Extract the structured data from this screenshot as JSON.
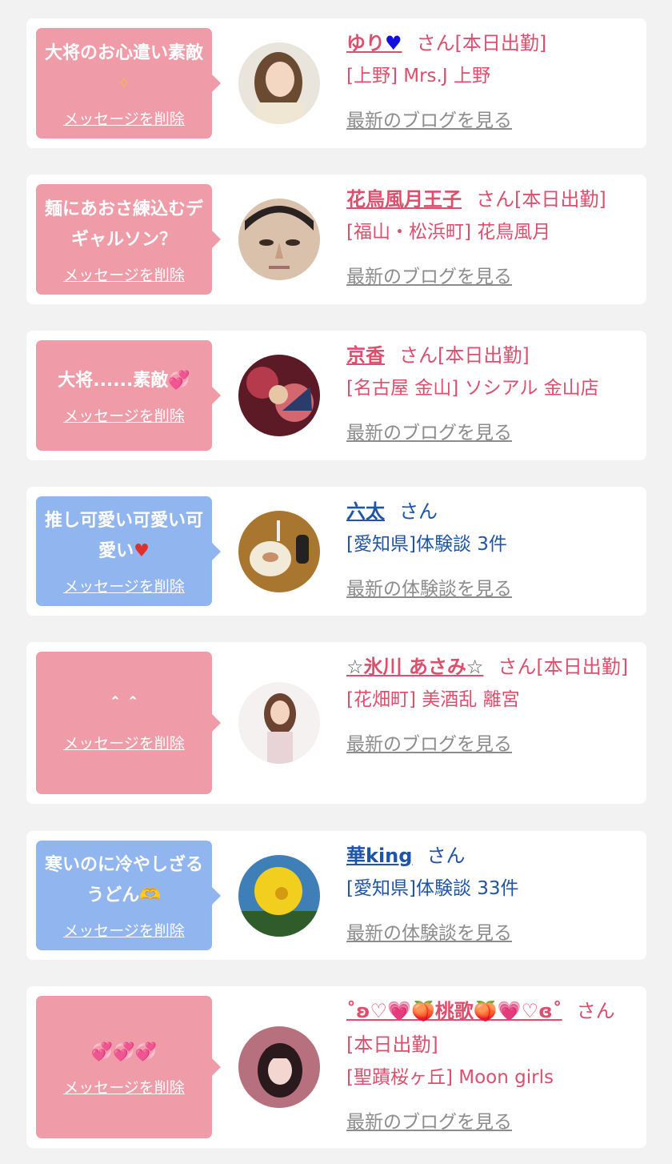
{
  "messages": [
    {
      "text": "大将のお心遣い素敵",
      "deco": "✧",
      "delete_label": "メッセージを削除",
      "name": "ゆり",
      "name_deco": "♥",
      "suffix": "さん[本日出勤]",
      "shop": "[上野] Mrs.J 上野",
      "link": "最新のブログを見る"
    },
    {
      "text": "麺にあおさ練込むデギャルソン？",
      "delete_label": "メッセージを削除",
      "name": "花鳥風月王子",
      "suffix": "さん[本日出勤]",
      "shop": "[福山・松浜町] 花鳥風月",
      "link": "最新のブログを見る"
    },
    {
      "text": "大将......素敵",
      "deco": "💞",
      "delete_label": "メッセージを削除",
      "name": "京香",
      "suffix": "さん[本日出勤]",
      "shop": "[名古屋 金山] ソシアル 金山店",
      "link": "最新のブログを見る"
    },
    {
      "text": "推し可愛い可愛い可愛い",
      "deco": "♥",
      "delete_label": "メッセージを削除",
      "name": "六太",
      "suffix": "さん",
      "shop": "[愛知県]体験談 3件",
      "link": "最新の体験談を見る"
    },
    {
      "text": "＾＾",
      "delete_label": "メッセージを削除",
      "name_pre": "☆",
      "name": "氷川 あさみ",
      "name_post": "☆",
      "suffix": "さん[本日出勤]",
      "shop": "[花畑町] 美酒乱 離宮",
      "link": "最新のブログを見る"
    },
    {
      "text": "寒いのに冷やしざるうどん",
      "deco": "🫶",
      "delete_label": "メッセージを削除",
      "name": "華king",
      "suffix": "さん",
      "shop": "[愛知県]体験談 33件",
      "link": "最新の体験談を見る"
    },
    {
      "text": "💞💞💞",
      "delete_label": "メッセージを削除",
      "name": "˚ʚ♡💗🍑桃歌🍑💗♡ɞ˚",
      "suffix": "さん[本日出勤]",
      "shop": "[聖蹟桜ヶ丘] Moon girls",
      "link": "最新のブログを見る"
    }
  ],
  "colors": {
    "pink_bubble": "#ef9ca8",
    "blue_bubble": "#91b5ee",
    "pink_text": "#dc4f6d",
    "blue_text": "#1f55a6",
    "link_gray": "#8c8c8c"
  },
  "avatar_icons": [
    "photo-woman-icon",
    "photo-man-face-icon",
    "photo-kimono-icon",
    "photo-plate-icon",
    "photo-woman-icon",
    "photo-hibiscus-icon",
    "photo-girl-icon"
  ]
}
